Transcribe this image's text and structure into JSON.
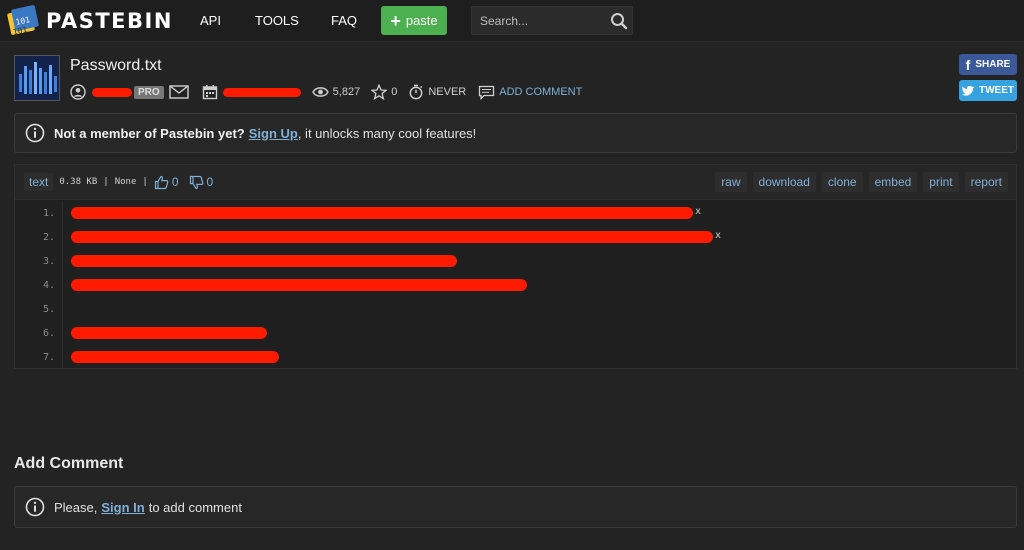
{
  "nav": {
    "logo_text": "PASTEBIN",
    "links": [
      "API",
      "TOOLS",
      "FAQ"
    ],
    "paste_button": "paste",
    "search_placeholder": "Search..."
  },
  "paste": {
    "title": "Password.txt",
    "pro_badge": "PRO",
    "views": "5,827",
    "stars": "0",
    "expiry": "NEVER",
    "add_comment": "ADD COMMENT"
  },
  "social": {
    "share": "SHARE",
    "tweet": "TWEET"
  },
  "notice": {
    "text_before": "Not a member of Pastebin yet?",
    "link": "Sign Up",
    "text_after": ", it unlocks many cool features!"
  },
  "code": {
    "syntax": "text",
    "size": "0.38 KB",
    "category": "None",
    "likes": "0",
    "dislikes": "0",
    "actions": [
      "raw",
      "download",
      "clone",
      "embed",
      "print",
      "report"
    ],
    "line_numbers": [
      "1.",
      "2.",
      "3.",
      "4.",
      "5.",
      "6.",
      "7."
    ],
    "line_tails": [
      "x",
      "x"
    ]
  },
  "comments": {
    "title": "Add Comment",
    "text_before": "Please,",
    "link": "Sign In",
    "text_after": "to add comment"
  }
}
